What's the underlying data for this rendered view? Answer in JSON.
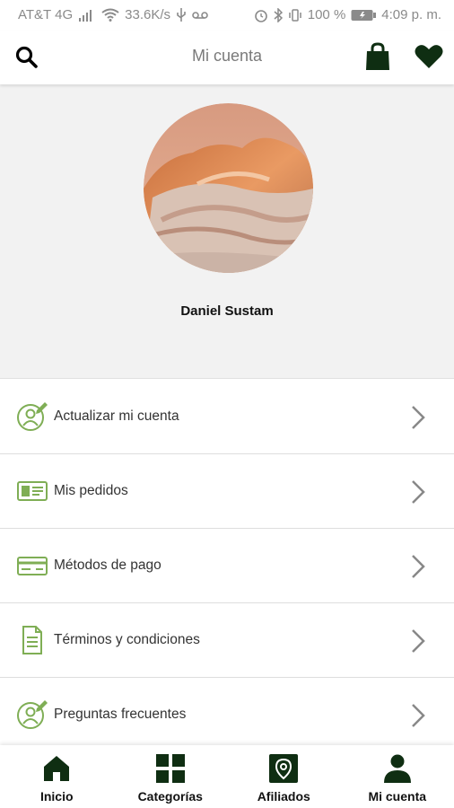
{
  "status_bar": {
    "carrier": "AT&T 4G",
    "speed": "33.6K/s",
    "battery": "100 %",
    "time": "4:09 p. m."
  },
  "app_bar": {
    "title": "Mi cuenta",
    "icons": [
      "search-icon",
      "shopping-bag-icon",
      "heart-icon"
    ]
  },
  "profile": {
    "name": "Daniel Sustam",
    "avatar": "desert-rock-photo"
  },
  "menu": {
    "items": [
      {
        "label": "Actualizar mi cuenta",
        "icon": "user-edit-icon"
      },
      {
        "label": "Mis pedidos",
        "icon": "orders-card-icon"
      },
      {
        "label": "Métodos de pago",
        "icon": "credit-card-icon"
      },
      {
        "label": "Términos y condiciones",
        "icon": "document-icon"
      },
      {
        "label": "Preguntas frecuentes",
        "icon": "user-edit-icon"
      }
    ]
  },
  "bottom_nav": {
    "items": [
      {
        "label": "Inicio",
        "icon": "home-icon"
      },
      {
        "label": "Categorías",
        "icon": "grid-icon"
      },
      {
        "label": "Afiliados",
        "icon": "location-badge-icon"
      },
      {
        "label": "Mi cuenta",
        "icon": "person-icon",
        "active": true
      }
    ]
  },
  "colors": {
    "accent_green": "#7fae55",
    "dark_green": "#0f2e12",
    "header_bg": "#f2f2f2"
  }
}
